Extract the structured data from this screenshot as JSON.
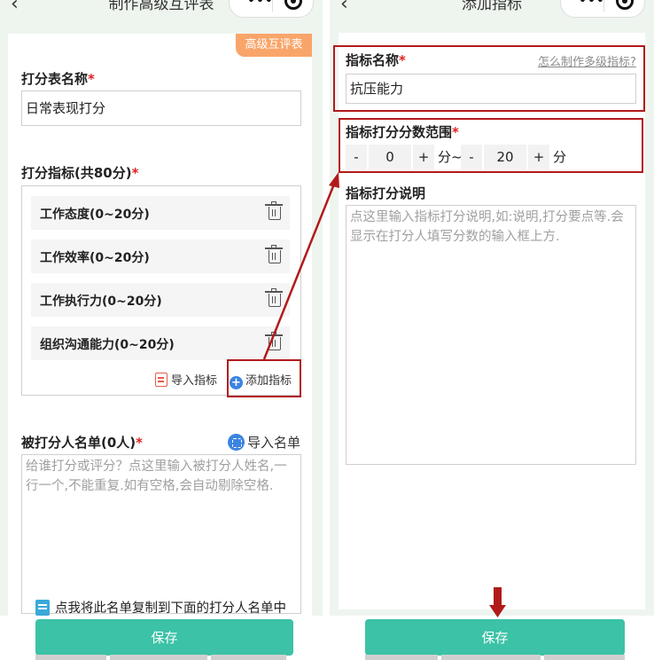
{
  "left": {
    "nav_title": "制作高级互评表",
    "nav_back": "‹",
    "badge": "高级互评表",
    "form_name_label": "打分表名称",
    "form_name_value": "日常表现打分",
    "indicators_label": "打分指标(共80分)",
    "indicators": [
      {
        "label": "工作态度(0~20分)"
      },
      {
        "label": "工作效率(0~20分)"
      },
      {
        "label": "工作执行力(0~20分)"
      },
      {
        "label": "组织沟通能力(0~20分)"
      }
    ],
    "import_indicators": "导入指标",
    "add_indicator": "添加指标",
    "rated_list_label": "被打分人名单(0人)",
    "import_list": "导入名单",
    "rated_list_placeholder": "给谁打分或评分？点这里输入被打分人姓名,一行一个,不能重复.如有空格,会自动剔除空格.",
    "copy_hint": "点我将此名单复制到下面的打分人名单中",
    "save": "保存"
  },
  "right": {
    "nav_title": "添加指标",
    "indicator_name_label": "指标名称",
    "help_link": "怎么制作多级指标?",
    "indicator_name_value": "抗压能力",
    "score_range_label": "指标打分分数范围",
    "min_value": "0",
    "max_value": "20",
    "minus": "-",
    "plus": "+",
    "unit_mid": "分~",
    "unit_end": "分",
    "desc_label": "指标打分说明",
    "desc_placeholder": "点这里输入指标打分说明,如:说明,打分要点等.会显示在打分人填写分数的输入框上方.",
    "save": "保存"
  },
  "required_mark": "*",
  "colors": {
    "accent": "#3cc2a6",
    "highlight": "#b21a1a",
    "badge": "#f9a56a",
    "link": "#3c84e0"
  }
}
